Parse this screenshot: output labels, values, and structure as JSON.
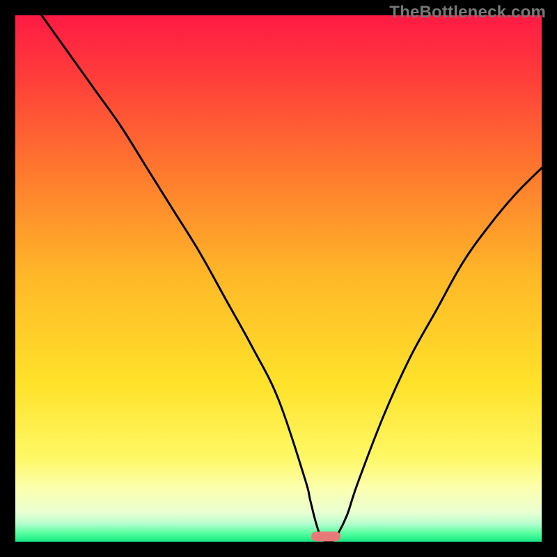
{
  "attribution": "TheBottleneck.com",
  "chart_data": {
    "type": "line",
    "title": "",
    "xlabel": "",
    "ylabel": "",
    "xlim": [
      0,
      100
    ],
    "ylim": [
      0,
      100
    ],
    "grid": false,
    "curve": {
      "name": "bottleneck-curve",
      "x": [
        5,
        10,
        15,
        20,
        25,
        30,
        35,
        40,
        45,
        50,
        55,
        56,
        57,
        58,
        59,
        60,
        61,
        63,
        65,
        70,
        75,
        80,
        85,
        90,
        95,
        100
      ],
      "y": [
        100,
        93,
        86,
        79,
        71,
        63,
        55,
        46,
        37,
        27,
        12,
        8,
        4,
        1,
        0,
        0,
        1,
        5,
        11,
        24,
        35,
        44,
        53,
        60,
        66,
        71
      ]
    },
    "marker": {
      "name": "minimum-marker",
      "x": 59,
      "y": 1,
      "color": "#e77a78"
    },
    "gradient_stops": [
      {
        "pos": 0.0,
        "color": "#ff1a44"
      },
      {
        "pos": 0.12,
        "color": "#ff3e3a"
      },
      {
        "pos": 0.3,
        "color": "#ff7a2e"
      },
      {
        "pos": 0.5,
        "color": "#ffb928"
      },
      {
        "pos": 0.7,
        "color": "#ffe22a"
      },
      {
        "pos": 0.84,
        "color": "#fff865"
      },
      {
        "pos": 0.9,
        "color": "#fcffb0"
      },
      {
        "pos": 0.945,
        "color": "#e9ffd2"
      },
      {
        "pos": 0.965,
        "color": "#b8ffcf"
      },
      {
        "pos": 0.985,
        "color": "#52ff9e"
      },
      {
        "pos": 1.0,
        "color": "#16e884"
      }
    ]
  }
}
